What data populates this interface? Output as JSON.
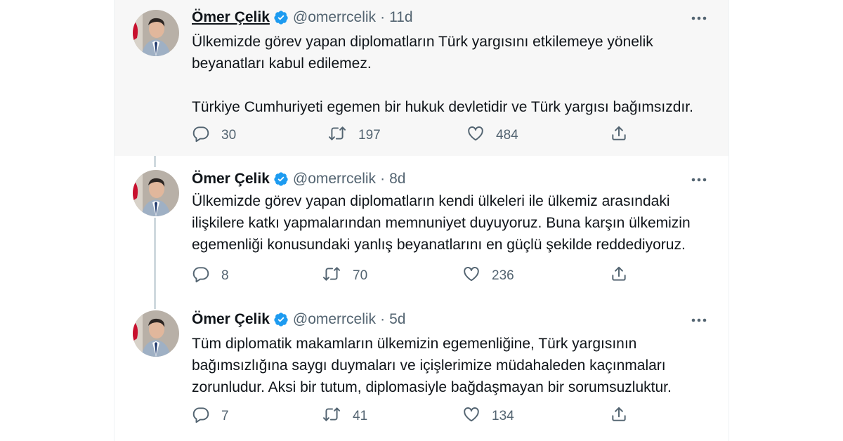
{
  "tweets": [
    {
      "author": "Ömer Çelik",
      "handle": "@omerrcelik",
      "time": "11d",
      "text": [
        "Ülkemizde görev yapan diplomatların Türk yargısını etkilemeye yönelik",
        "beyanatları kabul edilemez.",
        "",
        "Türkiye Cumhuriyeti egemen bir hukuk devletidir ve Türk yargısı bağımsızdır."
      ],
      "replies": "30",
      "retweets": "197",
      "likes": "484"
    },
    {
      "author": "Ömer Çelik",
      "handle": "@omerrcelik",
      "time": "8d",
      "text": [
        "Ülkemizde görev yapan diplomatların kendi ülkeleri ile ülkemiz arasındaki",
        "ilişkilere katkı yapmalarından memnuniyet duyuyoruz. Buna karşın ülkemizin",
        "egemenliği konusundaki yanlış beyanatlarını en güçlü şekilde reddediyoruz."
      ],
      "replies": "8",
      "retweets": "70",
      "likes": "236"
    },
    {
      "author": "Ömer Çelik",
      "handle": "@omerrcelik",
      "time": "5d",
      "text": [
        "Tüm diplomatik makamların ülkemizin egemenliğine, Türk yargısının",
        "bağımsızlığına saygı duymaları ve içişlerimize müdahaleden kaçınmaları",
        "zorunludur. Aksi bir tutum, diplomasiyle bağdaşmayan bir sorumsuzluktur."
      ],
      "replies": "7",
      "retweets": "41",
      "likes": "134"
    }
  ],
  "header_separator": "·",
  "icons": {
    "verified": "verified-badge-icon",
    "more": "more-icon",
    "reply": "reply-icon",
    "retweet": "retweet-icon",
    "like": "like-icon",
    "share": "share-icon"
  },
  "colors": {
    "verified": "#1d9bf0",
    "muted_text": "#536471",
    "highlight_background": "#f7f7f7",
    "thread_line": "#cfd9de"
  }
}
